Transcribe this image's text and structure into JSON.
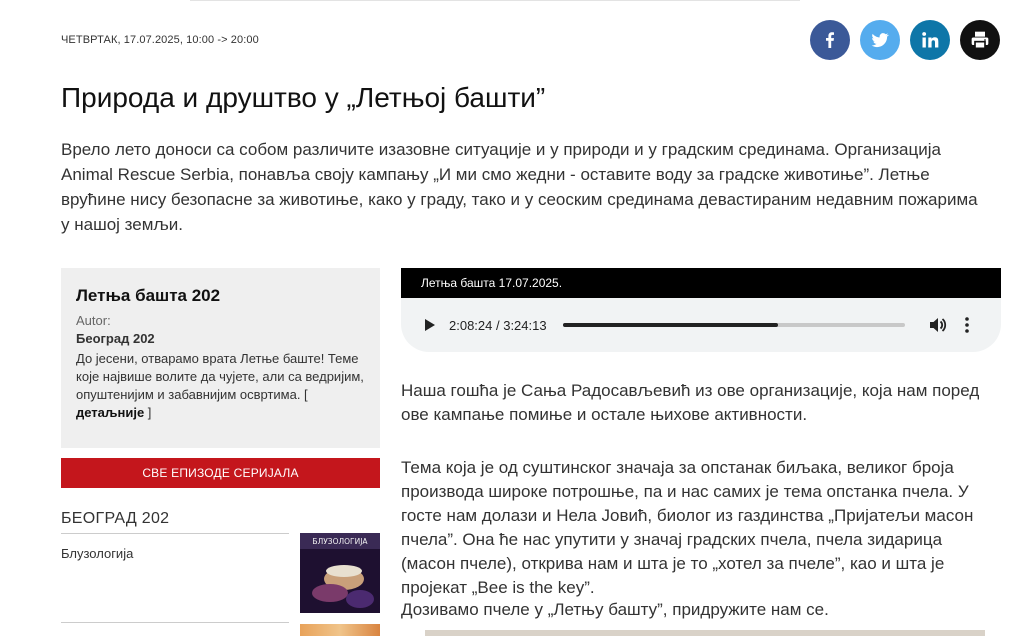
{
  "meta": {
    "date": "ЧЕТВРТАК, 17.07.2025,  10:00 -> 20:00"
  },
  "share": [
    {
      "icon": "facebook-icon",
      "color": "#3b5998"
    },
    {
      "icon": "twitter-icon",
      "color": "#55acee"
    },
    {
      "icon": "linkedin-icon",
      "color": "#0e76a8"
    },
    {
      "icon": "print-icon",
      "color": "#111111"
    }
  ],
  "article": {
    "title": "Природа и друштво у „Летњој башти”",
    "lead": "Врело лето доноси са собом различите изазовне ситуације и у природи и у градским срединама. Организација Animal Rescue Serbia, понавља своју кампању „И ми смо жедни - оставите воду за градске животиње”. Летње врућине нису безопасне за животиње, како у граду, тако и у сеоским срединама девастираним недавним пожарима у нашој земљи.",
    "paragraph1": "Наша гошћа је Сања Радосављевић из ове организације, која нам поред ове кампање помиње и остале њихове активности.",
    "paragraph2": "Тема која је од суштинског значаја за опстанак биљака, великог броја производа широке потрошње, па и нас самих је тема опстанка пчела. У госте нам долази и Нела Јовић, биолог из газдинства „Пријатељи масон пчела”. Она ће нас упутити у значај градских пчела, пчела зидарица (масон пчеле), открива нам и шта је то „хотел за пчеле”, као и шта је пројекат „Bee is the key”.",
    "paragraph3": "Дозивамо пчеле у „Летњу башту”, придружите нам се."
  },
  "series": {
    "title": "Летња башта 202",
    "author_label": "Autor:",
    "author": "Београд 202",
    "description": "До јесени, отварамо врата Летње баште! Теме које највише волите да чујете, али са ведријим, опуштенијим и забавнијим освртима. [",
    "details_link": "детаљније",
    "description_end": " ]",
    "all_episodes": "СВЕ ЕПИЗОДЕ СЕРИЈАЛА"
  },
  "sidebar": {
    "station_heading": "БЕОГРАД 202",
    "related": [
      {
        "title": "Блузологија",
        "thumb_text": "БЛУЗОЛОГИЈА"
      }
    ]
  },
  "player": {
    "header": "Летња башта 17.07.2025.",
    "current_time": "2:08:24",
    "total_time": "3:24:13",
    "time_display": "2:08:24 / 3:24:13",
    "progress": 0.629
  }
}
